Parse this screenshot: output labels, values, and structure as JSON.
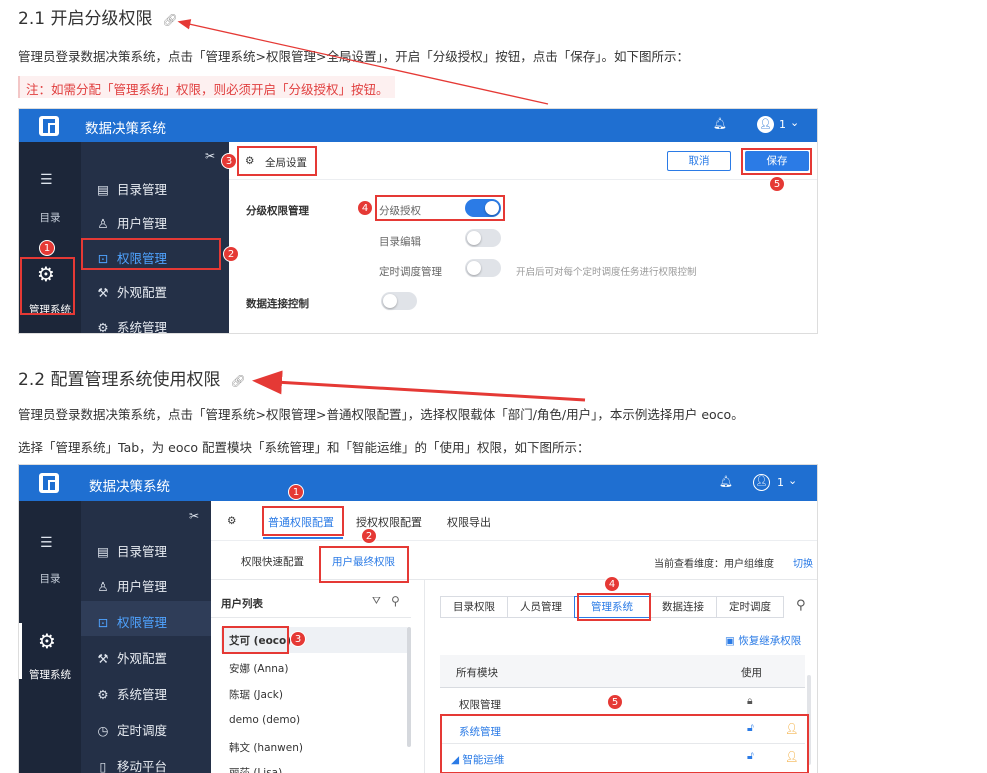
{
  "section1": {
    "heading": "2.1 开启分级权限",
    "para": "管理员登录数据决策系统，点击「管理系统>权限管理>全局设置」，开启「分级授权」按钮，点击「保存」。如下图所示：",
    "note": "注：如需分配「管理系统」权限，则必须开启「分级授权」按钮。",
    "shot": {
      "app_title": "数据决策系统",
      "user_count": "1",
      "rail": {
        "catalog_label": "目录",
        "manage_label": "管理系统"
      },
      "menu": [
        "目录管理",
        "用户管理",
        "权限管理",
        "外观配置",
        "系统管理"
      ],
      "global_settings": "全局设置",
      "cancel": "取消",
      "save": "保存",
      "rows": {
        "hier_mgmt": "分级权限管理",
        "hier_auth": "分级授权",
        "catalog_edit": "目录编辑",
        "schedule_mgmt": "定时调度管理",
        "schedule_hint": "开启后可对每个定时调度任务进行权限控制",
        "data_conn": "数据连接控制"
      },
      "badges": [
        "1",
        "2",
        "3",
        "4",
        "5"
      ]
    }
  },
  "section2": {
    "heading": "2.2 配置管理系统使用权限",
    "para1": "管理员登录数据决策系统，点击「管理系统>权限管理>普通权限配置」，选择权限载体「部门/角色/用户」，本示例选择用户 eoco。",
    "para2": "选择「管理系统」Tab，为 eoco 配置模块「系统管理」和「智能运维」的「使用」权限，如下图所示：",
    "shot": {
      "app_title": "数据决策系统",
      "user_count": "1",
      "rail": {
        "catalog_label": "目录",
        "manage_label": "管理系统"
      },
      "menu": [
        "目录管理",
        "用户管理",
        "权限管理",
        "外观配置",
        "系统管理",
        "定时调度",
        "移动平台"
      ],
      "top_tabs": [
        "普通权限配置",
        "授权权限配置",
        "权限导出"
      ],
      "sub_tabs": [
        "权限快速配置",
        "用户最终权限"
      ],
      "dimension": "当前查看维度：用户组维度",
      "switch": "切换",
      "user_list_title": "用户列表",
      "users": [
        "艾可 (eoco)",
        "安娜 (Anna)",
        "陈琚 (Jack)",
        "demo (demo)",
        "韩文 (hanwen)",
        "丽莎 (Lisa)"
      ],
      "perm_tabs": [
        "目录权限",
        "人员管理",
        "管理系统",
        "数据连接",
        "定时调度"
      ],
      "restore": "恢复继承权限",
      "col_module": "所有模块",
      "col_use": "使用",
      "modules": [
        "权限管理",
        "系统管理",
        "智能运维"
      ],
      "badges": [
        "1",
        "2",
        "3",
        "4",
        "5"
      ]
    }
  },
  "colors": {
    "primary": "#1f6fd1",
    "sidebar_dark": "#1c2639",
    "sidebar": "#243047",
    "annotation_red": "#e53935",
    "note_red": "#e03e3e"
  }
}
